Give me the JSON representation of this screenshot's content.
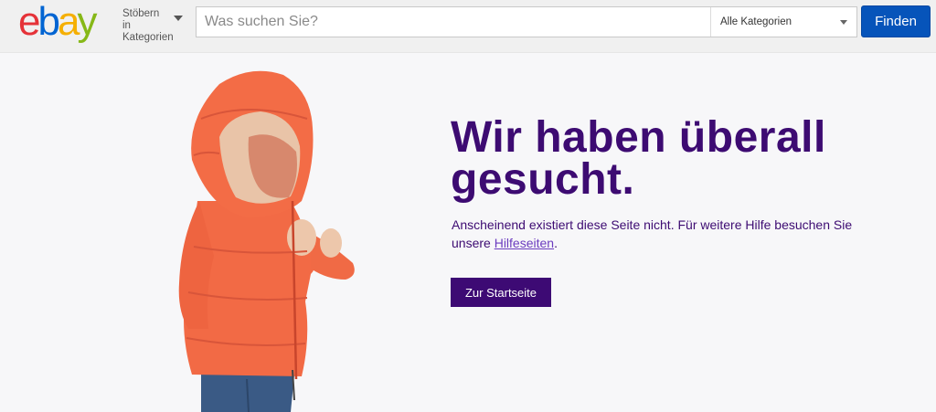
{
  "header": {
    "logo_text": "ebay",
    "logo_colors": [
      "#e53238",
      "#0064d2",
      "#f5af02",
      "#86b817"
    ],
    "browse_label": "Stöbern in Kategorien",
    "search": {
      "placeholder": "Was suchen Sie?",
      "value": ""
    },
    "category_select": {
      "selected": "Alle Kategorien"
    },
    "find_label": "Finden",
    "find_color": "#0654ba"
  },
  "main": {
    "headline": "Wir haben überall gesucht.",
    "message_before_link": "Anscheinend existiert diese Seite nicht. Für weitere Hilfe besuchen Sie unsere ",
    "help_link": "Hilfeseiten",
    "message_after_link": ".",
    "home_button": "Zur Startseite",
    "accent_color": "#3d0b72"
  }
}
